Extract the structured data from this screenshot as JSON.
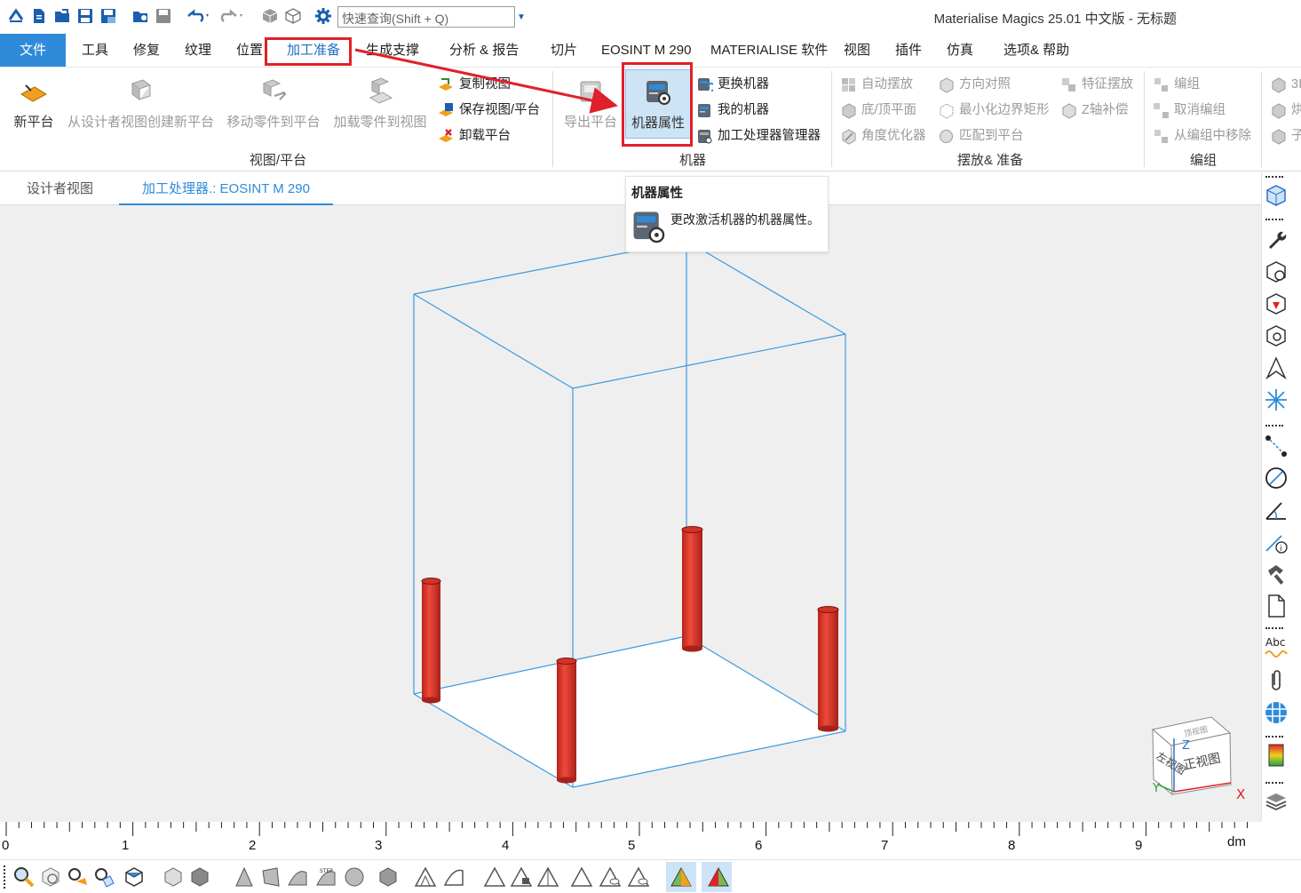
{
  "window": {
    "title": "Materialise Magics 25.01 中文版 - 无标题",
    "search_placeholder": "快速查询(Shift + Q)"
  },
  "menu": {
    "tabs": [
      "文件",
      "工具",
      "修复",
      "纹理",
      "位置",
      "加工准备",
      "生成支撑",
      "分析 & 报告",
      "切片",
      "EOSINT M 290",
      "MATERIALISE 软件",
      "视图",
      "插件",
      "仿真",
      "选项& 帮助"
    ],
    "active_tab": "加工准备"
  },
  "ribbon": {
    "view_platform": {
      "label": "视图/平台",
      "new_platform": "新平台",
      "from_designer": "从设计者视图创建新平台",
      "move_parts": "移动零件到平台",
      "load_parts": "加载零件到视图",
      "copy_view": "复制视图",
      "save_view": "保存视图/平台",
      "unload_platform": "卸载平台"
    },
    "machine": {
      "label": "机器",
      "export_platform": "导出平台",
      "machine_properties": "机器属性",
      "change_machine": "更换机器",
      "my_machine": "我的机器",
      "processor_manager": "加工处理器管理器"
    },
    "placement": {
      "label": "摆放& 准备",
      "auto_place": "自动摆放",
      "orientation": "方向对照",
      "feature_place": "特征摆放",
      "bottom_top": "底/顶平面",
      "min_bbox": "最小化边界矩形",
      "z_comp": "Z轴补偿",
      "angle_opt": "角度优化器",
      "match_platform": "匹配到平台"
    },
    "group": {
      "label": "编组",
      "group": "编组",
      "ungroup": "取消编组",
      "remove_from_group": "从编组中移除"
    },
    "extra": {
      "item1": "3I",
      "item2": "烘",
      "item3": "子"
    }
  },
  "doc_tabs": [
    "设计者视图",
    "加工处理器.: EOSINT M 290"
  ],
  "active_doc_tab": "加工处理器.: EOSINT M 290",
  "tooltip": {
    "title": "机器属性",
    "description": "更改激活机器的机器属性。"
  },
  "view_cube": {
    "front": "正视图",
    "left": "左视图",
    "top": "顶视图",
    "axis_x": "X",
    "axis_y": "Y",
    "axis_z": "Z"
  },
  "ruler": {
    "labels": [
      "0",
      "1",
      "2",
      "3",
      "4",
      "5",
      "6",
      "7",
      "8",
      "9"
    ],
    "unit": "dm"
  },
  "colors": {
    "accent": "#2f8bd9",
    "highlight": "#e0202a",
    "part_red": "#e03a2e",
    "build_box": "#3a9ae0"
  }
}
